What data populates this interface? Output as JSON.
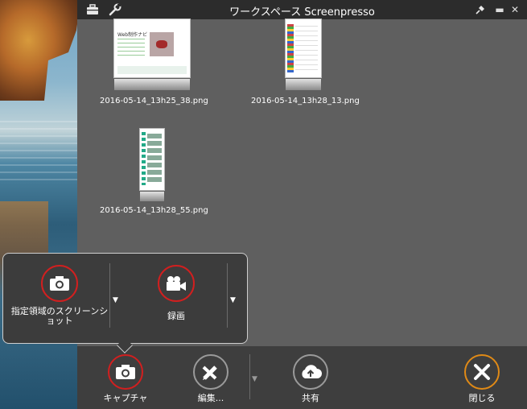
{
  "window": {
    "title": "ワークスペース Screenpresso",
    "icons": [
      "briefcase-icon",
      "wrench-icon",
      "pin-icon",
      "minimize-icon",
      "close-icon"
    ]
  },
  "workspace": {
    "thumbnails": [
      {
        "caption": "2016-05-14_13h25_38.png",
        "preview_title": "Web制作ナビ"
      },
      {
        "caption": "2016-05-14_13h28_13.png"
      },
      {
        "caption": "2016-05-14_13h28_55.png"
      }
    ]
  },
  "popup": {
    "screenshot_label": "指定領域のスクリーンショット",
    "video_label": "録画"
  },
  "toolbar": {
    "capture_label": "キャプチャ",
    "edit_label": "編集...",
    "share_label": "共有",
    "close_label": "閉じる"
  },
  "colors": {
    "highlight": "#d21f1f",
    "close_accent": "#e08a16",
    "titlebar": "#2c2c2c",
    "workspace_bg": "#5f5f5f"
  }
}
